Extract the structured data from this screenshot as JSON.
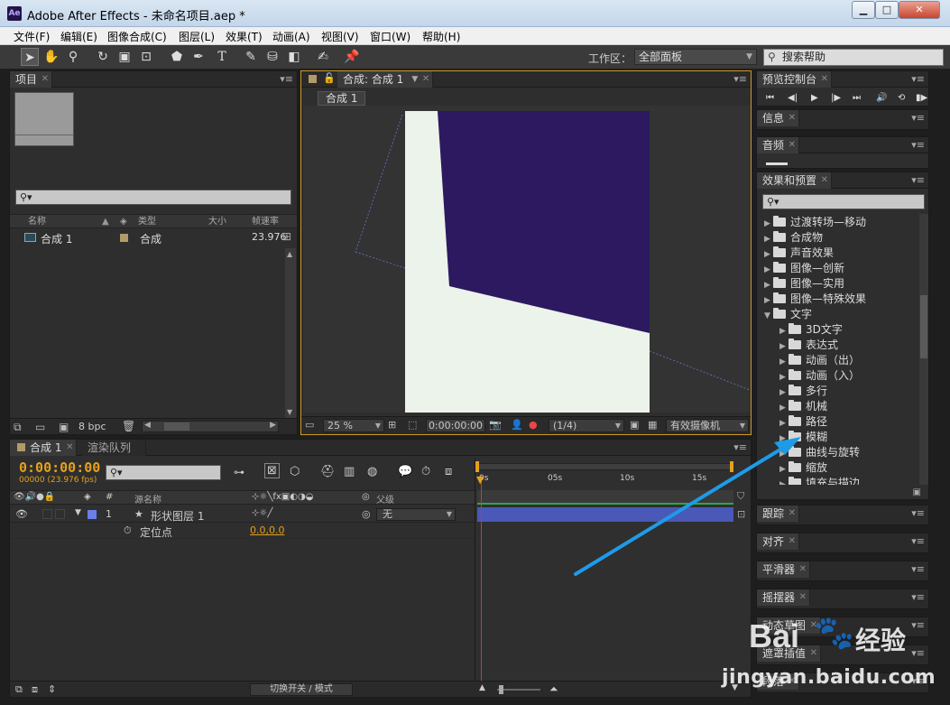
{
  "window": {
    "app_icon": "Ae",
    "title": "Adobe After Effects - 未命名项目.aep *",
    "minimize": "▁",
    "maximize": "□",
    "close": "✕"
  },
  "menu": [
    "文件(F)",
    "编辑(E)",
    "图像合成(C)",
    "图层(L)",
    "效果(T)",
    "动画(A)",
    "视图(V)",
    "窗口(W)",
    "帮助(H)"
  ],
  "toolbar": {
    "workspace_label": "工作区：",
    "workspace_value": "全部面板",
    "help_search": "搜索帮助"
  },
  "project": {
    "tab": "项目",
    "columns": [
      "名称",
      "类型",
      "大小",
      "帧速率"
    ],
    "items": [
      {
        "name": "合成 1",
        "type": "合成",
        "fps": "23.976"
      }
    ],
    "bpc": "8 bpc"
  },
  "composition": {
    "tab": "合成: 合成 1",
    "breadcrumb": "合成 1",
    "zoom": "25 %",
    "timecode": "0:00:00:00",
    "resolution": "(1/4)",
    "camera": "有效摄像机",
    "colors": {
      "shape_fill": "#2c1960",
      "comp_bg": "#ecf3ea",
      "pasteboard": "#333333"
    }
  },
  "timeline": {
    "tab_comp": "合成 1",
    "tab_render": "渲染队列",
    "current_time": "0:00:00:00",
    "frame_info": "00000 (23.976 fps)",
    "col_source": "源名称",
    "col_parent": "父级",
    "layers": [
      {
        "index": "1",
        "name": "形状图层 1",
        "parent": "无"
      }
    ],
    "property": {
      "name": "定位点",
      "value": "0.0,0.0"
    },
    "ruler": [
      "0s",
      "05s",
      "10s",
      "15s"
    ],
    "footer_toggle": "切换开关 / 模式"
  },
  "right_panels": {
    "preview": "预览控制台",
    "info": "信息",
    "audio": "音频",
    "effects": "效果和预置",
    "tracker": "跟踪",
    "align": "对齐",
    "smoother": "平滑器",
    "wiggler": "摇摆器",
    "motion_sketch": "动态草图",
    "mask_interpolation": "遮罩插值",
    "paragraph": "段落"
  },
  "effects_tree": [
    {
      "label": "过渡转场—移动",
      "level": 0,
      "open": false
    },
    {
      "label": "合成物",
      "level": 0,
      "open": false
    },
    {
      "label": "声音效果",
      "level": 0,
      "open": false
    },
    {
      "label": "图像—创新",
      "level": 0,
      "open": false
    },
    {
      "label": "图像—实用",
      "level": 0,
      "open": false
    },
    {
      "label": "图像—特殊效果",
      "level": 0,
      "open": false
    },
    {
      "label": "文字",
      "level": 0,
      "open": true
    },
    {
      "label": "3D文字",
      "level": 1,
      "open": false
    },
    {
      "label": "表达式",
      "level": 1,
      "open": false
    },
    {
      "label": "动画（出）",
      "level": 1,
      "open": false
    },
    {
      "label": "动画（入）",
      "level": 1,
      "open": false
    },
    {
      "label": "多行",
      "level": 1,
      "open": false
    },
    {
      "label": "机械",
      "level": 1,
      "open": false
    },
    {
      "label": "路径",
      "level": 1,
      "open": false
    },
    {
      "label": "模糊",
      "level": 1,
      "open": false
    },
    {
      "label": "曲线与旋转",
      "level": 1,
      "open": false
    },
    {
      "label": "缩放",
      "level": 1,
      "open": false
    },
    {
      "label": "填充与描边",
      "level": 1,
      "open": false
    }
  ],
  "watermark": {
    "brand": "Bai",
    "brand_cn": "经验",
    "url": "jingyan.baidu.com"
  }
}
